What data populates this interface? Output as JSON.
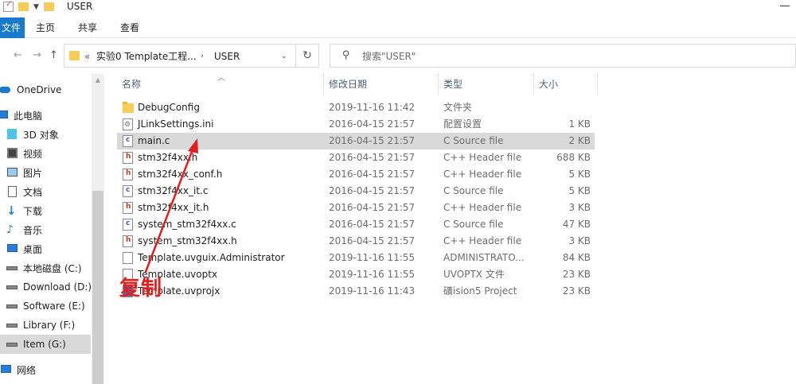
{
  "window": {
    "title": "USER"
  },
  "ribbon": {
    "file_tab": "文件",
    "tabs": [
      "主页",
      "共享",
      "查看"
    ]
  },
  "address": {
    "crumb_prefix": "«",
    "crumbs": [
      "实验0 Template工程...",
      "USER"
    ],
    "search_placeholder": "搜索\"USER\""
  },
  "nav": {
    "items": [
      {
        "label": "OneDrive",
        "icon": "cloud-icon"
      },
      {
        "label": "此电脑",
        "icon": "computer-icon"
      },
      {
        "label": "3D 对象",
        "icon": "cube-icon"
      },
      {
        "label": "视频",
        "icon": "video-icon"
      },
      {
        "label": "图片",
        "icon": "picture-icon"
      },
      {
        "label": "文档",
        "icon": "document-icon"
      },
      {
        "label": "下载",
        "icon": "download-icon"
      },
      {
        "label": "音乐",
        "icon": "music-icon"
      },
      {
        "label": "桌面",
        "icon": "desktop-icon"
      },
      {
        "label": "本地磁盘 (C:)",
        "icon": "drive-icon"
      },
      {
        "label": "Download (D:)",
        "icon": "drive-icon"
      },
      {
        "label": "Software (E:)",
        "icon": "drive-icon"
      },
      {
        "label": "Library (F:)",
        "icon": "drive-icon"
      },
      {
        "label": "Item (G:)",
        "icon": "drive-icon"
      },
      {
        "label": "网络",
        "icon": "network-icon"
      }
    ]
  },
  "columns": {
    "name": "名称",
    "date": "修改日期",
    "type": "类型",
    "size": "大小"
  },
  "files": [
    {
      "name": "DebugConfig",
      "date": "2019-11-16 11:42",
      "type": "文件夹",
      "size": "",
      "icon": "folder"
    },
    {
      "name": "JLinkSettings.ini",
      "date": "2016-04-15 21:57",
      "type": "配置设置",
      "size": "1 KB",
      "icon": "ini"
    },
    {
      "name": "main.c",
      "date": "2016-04-15 21:57",
      "type": "C Source file",
      "size": "2 KB",
      "icon": "c"
    },
    {
      "name": "stm32f4xx.h",
      "date": "2016-04-15 21:57",
      "type": "C++ Header file",
      "size": "688 KB",
      "icon": "h"
    },
    {
      "name": "stm32f4xx_conf.h",
      "date": "2016-04-15 21:57",
      "type": "C++ Header file",
      "size": "5 KB",
      "icon": "h"
    },
    {
      "name": "stm32f4xx_it.c",
      "date": "2016-04-15 21:57",
      "type": "C Source file",
      "size": "5 KB",
      "icon": "c"
    },
    {
      "name": "stm32f4xx_it.h",
      "date": "2016-04-15 21:57",
      "type": "C++ Header file",
      "size": "3 KB",
      "icon": "h"
    },
    {
      "name": "system_stm32f4xx.c",
      "date": "2016-04-15 21:57",
      "type": "C Source file",
      "size": "47 KB",
      "icon": "c"
    },
    {
      "name": "system_stm32f4xx.h",
      "date": "2016-04-15 21:57",
      "type": "C++ Header file",
      "size": "3 KB",
      "icon": "h"
    },
    {
      "name": "Template.uvguix.Administrator",
      "date": "2019-11-16 11:55",
      "type": "ADMINISTRATO...",
      "size": "84 KB",
      "icon": "doc"
    },
    {
      "name": "Template.uvoptx",
      "date": "2019-11-16 11:55",
      "type": "UVOPTX 文件",
      "size": "23 KB",
      "icon": "doc"
    },
    {
      "name": "Template.uvprojx",
      "date": "2019-11-16 11:43",
      "type": "礦ision5 Project",
      "size": "23 KB",
      "icon": "doc"
    }
  ],
  "annotation": {
    "text": "复制",
    "color": "#e02020"
  },
  "colors": {
    "accent": "#1979ca",
    "selection": "#d9d9d9"
  }
}
